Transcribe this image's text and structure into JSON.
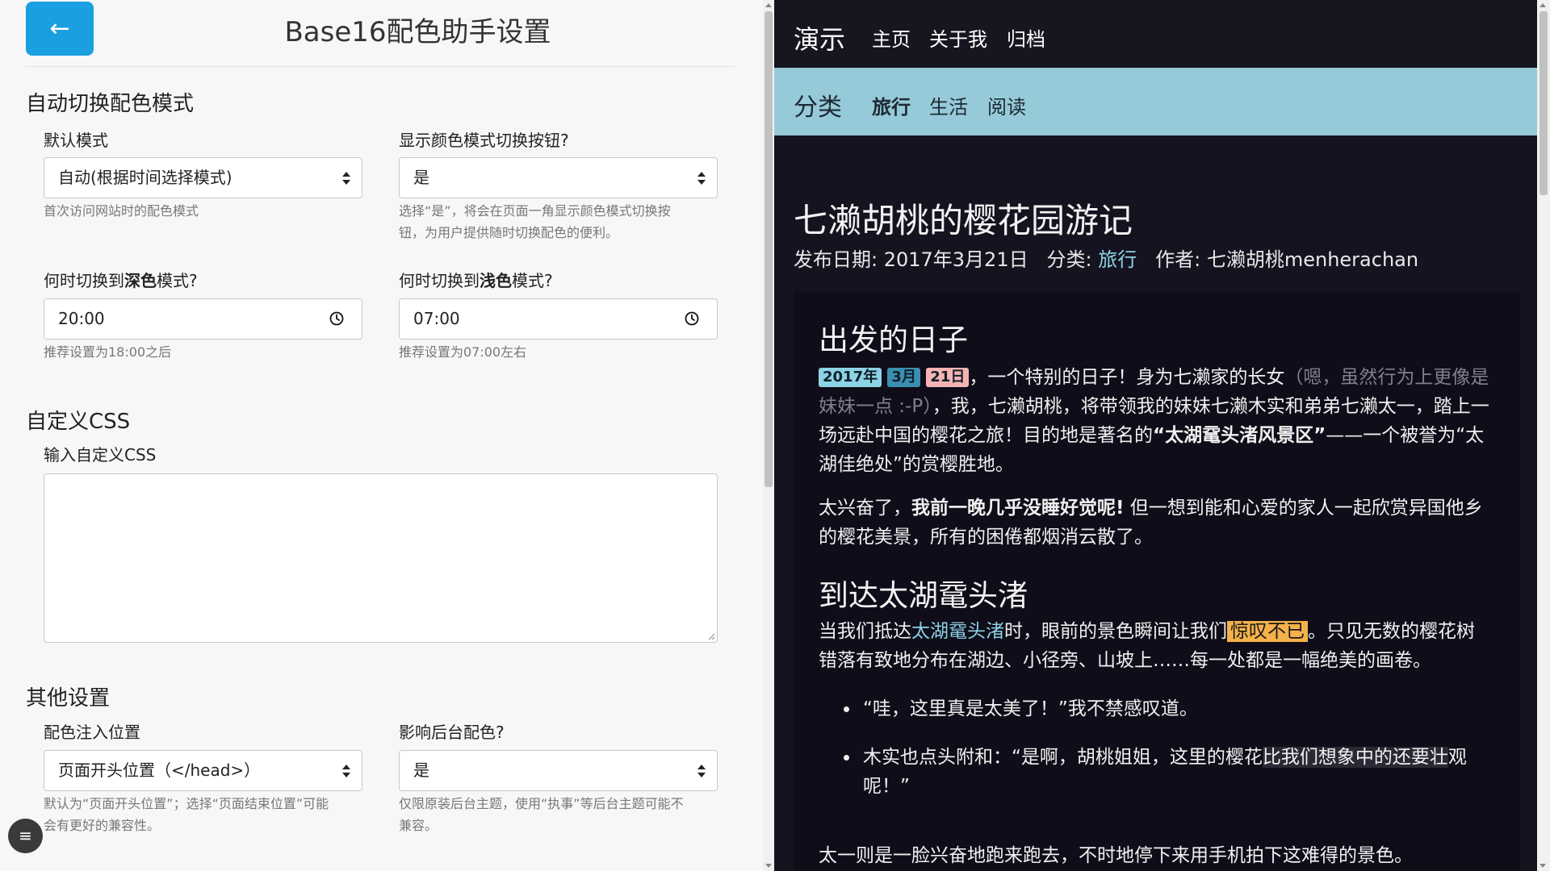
{
  "settings": {
    "back_label": "←",
    "title": "Base16配色助手设置",
    "auto_switch": {
      "heading": "自动切换配色模式",
      "default_mode": {
        "label": "默认模式",
        "value": "自动(根据时间选择模式)",
        "help": "首次访问网站时的配色模式"
      },
      "show_toggle": {
        "label": "显示颜色模式切换按钮?",
        "value": "是",
        "help_line1": "选择“是”，将会在页面一角显示颜色模式切换按",
        "help_line2": "钮，为用户提供随时切换配色的便利。"
      },
      "dark_time": {
        "label_prefix": "何时切换到",
        "label_bold": "深色",
        "label_suffix": "模式?",
        "value": "20:00",
        "help": "推荐设置为18:00之后"
      },
      "light_time": {
        "label_prefix": "何时切换到",
        "label_bold": "浅色",
        "label_suffix": "模式?",
        "value": "07:00",
        "help": "推荐设置为07:00左右"
      }
    },
    "custom_css": {
      "heading": "自定义CSS",
      "label": "输入自定义CSS",
      "value": ""
    },
    "other": {
      "heading": "其他设置",
      "inject_position": {
        "label": "配色注入位置",
        "value": "页面开头位置（</head>）",
        "help_line1": "默认为“页面开头位置”；选择“页面结束位置”可能",
        "help_line2": "会有更好的兼容性。"
      },
      "affect_admin": {
        "label": "影响后台配色?",
        "value": "是",
        "help_line1": "仅限原装后台主题，使用“执事”等后台主题可能不",
        "help_line2": "兼容。"
      }
    },
    "menu_icon": "≡"
  },
  "preview": {
    "brand": "演示",
    "nav": [
      "主页",
      "关于我",
      "归档"
    ],
    "category_label": "分类",
    "categories": [
      "旅行",
      "生活",
      "阅读"
    ],
    "post": {
      "title": "七濑胡桃的樱花园游记",
      "meta_date": "发布日期: 2017年3月21日",
      "meta_cat_prefix": "分类:",
      "meta_cat": "旅行",
      "meta_author": "作者: 七濑胡桃menherachan",
      "h_depart": "出发的日子",
      "tags": [
        {
          "text": "2017年",
          "color": "#8dd3e6"
        },
        {
          "text": "3月",
          "color": "#3a8fb0"
        },
        {
          "text": "21日",
          "color": "#f7b3b3"
        }
      ],
      "p1_a": "，一个特别的日子！身为七濑家的长女",
      "p1_muted": "（嗯，虽然行为上更像是妹妹一点 :-P）",
      "p1_b": "，我，七濑胡桃，将带领我的妹妹七濑木实和弟弟七濑太一，踏上一场远赴中国的樱花之旅！目的地是著名的",
      "p1_bold": "“太湖鼋头渚风景区”",
      "p1_c": "——一个被誉为“太湖佳绝处”的赏樱胜地。",
      "p2_a": "太兴奋了，",
      "p2_bold": "我前一晚几乎没睡好觉呢!",
      "p2_b": " 但一想到能和心爱的家人一起欣赏异国他乡的樱花美景，所有的困倦都烟消云散了。",
      "h_arrive": "到达太湖鼋头渚",
      "p3_a": "当我们抵达",
      "p3_link": "太湖鼋头渚",
      "p3_b": "时，眼前的景色瞬间让我们",
      "p3_hl": "惊叹不已",
      "p3_c": "。只见无数的樱花树错落有致地分布在湖边、小径旁、山坡上……每一处都是一幅绝美的画卷。",
      "bullet1": "“哇，这里真是太美了！”我不禁感叹道。",
      "bullet2_a": "木实也点头附和：“是啊，胡桃姐姐，这里的樱花",
      "bullet2_hl": "比我们想象中的还要壮",
      "bullet2_b": "观呢！”",
      "p4": "太一则是一脸兴奋地跑来跑去，不时地停下来用手机拍下这难得的景色。"
    }
  }
}
